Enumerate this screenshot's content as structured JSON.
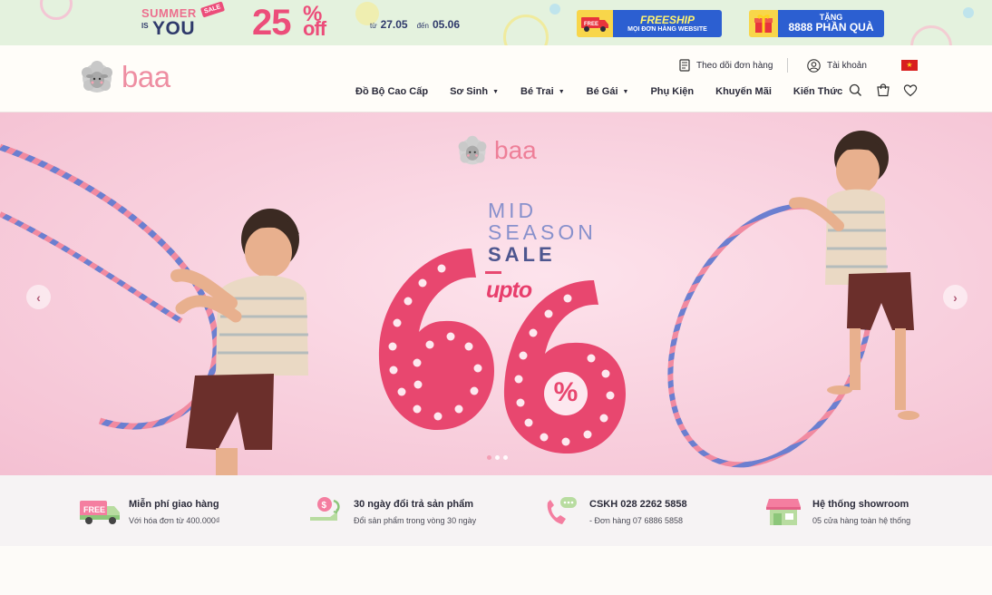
{
  "promo": {
    "summer": "SUMMER",
    "is": "IS",
    "you": "YOU",
    "sale_tag": "SALE",
    "percent_number": "25",
    "percent_sign": "%",
    "percent_off": "off",
    "date_from_label": "từ",
    "date_from": "27.05",
    "date_to_label": "đến",
    "date_to": "05.06",
    "freeship_title": "FREESHIP",
    "freeship_sub": "MỌI ĐƠN HÀNG WEBSITE",
    "freeship_truck_label": "FREE",
    "gift_title": "TẶNG",
    "gift_sub": "8888 PHẦN QUÀ"
  },
  "header": {
    "brand": "baa",
    "track_order": "Theo dõi đơn hàng",
    "account": "Tài khoản",
    "language_flag": "★",
    "nav": [
      {
        "label": "Đồ Bộ Cao Cấp",
        "has_caret": false
      },
      {
        "label": "Sơ Sinh",
        "has_caret": true
      },
      {
        "label": "Bé Trai",
        "has_caret": true
      },
      {
        "label": "Bé Gái",
        "has_caret": true
      },
      {
        "label": "Phụ Kiện",
        "has_caret": false
      },
      {
        "label": "Khuyến Mãi",
        "has_caret": false
      },
      {
        "label": "Kiến Thức",
        "has_caret": false
      }
    ],
    "caret": "▼",
    "icons": [
      "search-icon",
      "cart-icon",
      "heart-icon"
    ]
  },
  "hero": {
    "brand": "baa",
    "line1": "MID",
    "line2": "SEASON",
    "line3": "SALE",
    "upto": "upto",
    "big_number": "66",
    "percent": "%",
    "prev": "‹",
    "next": "›",
    "slide_count": 3,
    "active_slide": 1
  },
  "features": [
    {
      "title": "Miễn phí giao hàng",
      "sub": "Với hóa đơn từ 400.000₫",
      "icon": "free-truck-icon",
      "icon_label": "FREE"
    },
    {
      "title": "30 ngày đổi trả sản phẩm",
      "sub": "Đổi sản phẩm trong vòng 30 ngày",
      "icon": "return-coin-icon"
    },
    {
      "title": "CSKH 028 2262 5858",
      "sub": "- Đơn hàng 07 6886 5858",
      "icon": "phone-chat-icon"
    },
    {
      "title": "Hệ thống showroom",
      "sub": "05 cửa hàng toàn hệ thống",
      "icon": "showroom-icon"
    }
  ],
  "colors": {
    "brand_pink": "#ee8ea2",
    "sale_red": "#e84870",
    "promo_bg": "#e4f2de",
    "hero_bg": "#f8cfdd",
    "navy": "#2f3a6b",
    "freeship_blue": "#2c5fd1"
  }
}
